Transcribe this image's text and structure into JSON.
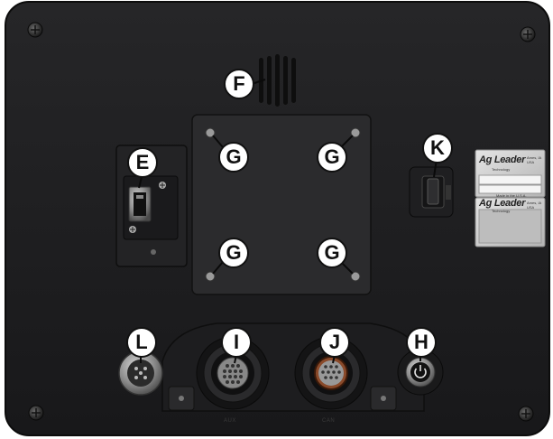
{
  "callouts": {
    "e": "E",
    "f": "F",
    "g1": "G",
    "g2": "G",
    "g3": "G",
    "g4": "G",
    "h": "H",
    "i": "I",
    "j": "J",
    "k": "K",
    "l": "L"
  },
  "labels": {
    "brand_top": "Ag Leader",
    "brand_top_sub": "Technology",
    "brand_top_city": "Ames, IA USA",
    "made_in": "Made in the U.S.A.",
    "brand_bottom": "Ag Leader",
    "brand_bottom_sub": "Technology",
    "brand_bottom_city": "Ames, IA USA",
    "port_i": "AUX",
    "port_j": "CAN"
  },
  "colors": {
    "housing": "#1c1c1e",
    "mount_plate": "#2a2a2c",
    "callout_fill": "#ffffff",
    "callout_text": "#111111",
    "label_silver": "#c9c9c9"
  }
}
